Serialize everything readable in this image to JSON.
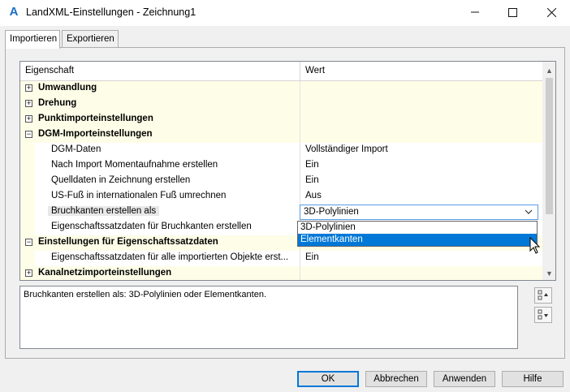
{
  "window": {
    "title": "LandXML-Einstellungen - Zeichnung1",
    "app_icon": "A",
    "minimize_icon": "minimize-icon",
    "maximize_icon": "maximize-icon",
    "close_icon": "close-icon"
  },
  "tabs": [
    {
      "label": "Importieren",
      "active": true
    },
    {
      "label": "Exportieren",
      "active": false
    }
  ],
  "grid": {
    "headers": {
      "property": "Eigenschaft",
      "value": "Wert"
    },
    "rows": [
      {
        "label": "Umwandlung",
        "type": "category",
        "expander": "+",
        "value": ""
      },
      {
        "label": "Drehung",
        "type": "category",
        "expander": "+",
        "value": ""
      },
      {
        "label": "Punktimporteinstellungen",
        "type": "category",
        "expander": "+",
        "value": ""
      },
      {
        "label": "DGM-Importeinstellungen",
        "type": "category",
        "expander": "−",
        "value": ""
      },
      {
        "label": "DGM-Daten",
        "type": "child",
        "value": "Vollständiger Import"
      },
      {
        "label": "Nach Import Momentaufnahme erstellen",
        "type": "child",
        "value": "Ein"
      },
      {
        "label": "Quelldaten in Zeichnung erstellen",
        "type": "child",
        "value": "Ein"
      },
      {
        "label": "US-Fuß in internationalen Fuß umrechnen",
        "type": "child",
        "value": "Aus"
      },
      {
        "label": "Bruchkanten erstellen als",
        "type": "child",
        "value": "3D-Polylinien",
        "editing": true
      },
      {
        "label": "Eigenschaftssatzdaten für Bruchkanten erstellen",
        "type": "child",
        "value": ""
      },
      {
        "label": "Einstellungen für Eigenschaftssatzdaten",
        "type": "category",
        "expander": "−",
        "value": ""
      },
      {
        "label": "Eigenschaftssatzdaten für alle importierten Objekte erst...",
        "type": "child",
        "value": "Ein"
      },
      {
        "label": "Kanalnetzimporteinstellungen",
        "type": "category",
        "expander": "+",
        "value": ""
      }
    ]
  },
  "dropdown": {
    "options": [
      "3D-Polylinien",
      "Elementkanten"
    ],
    "highlighted_index": 1
  },
  "description": "Bruchkanten erstellen als: 3D-Polylinien oder Elementkanten.",
  "buttons": {
    "ok": "OK",
    "cancel": "Abbrechen",
    "apply": "Anwenden",
    "help": "Hilfe"
  },
  "colors": {
    "category_bg": "#fefee8",
    "accent": "#0078d7",
    "app_icon": "#1a6fc4"
  }
}
